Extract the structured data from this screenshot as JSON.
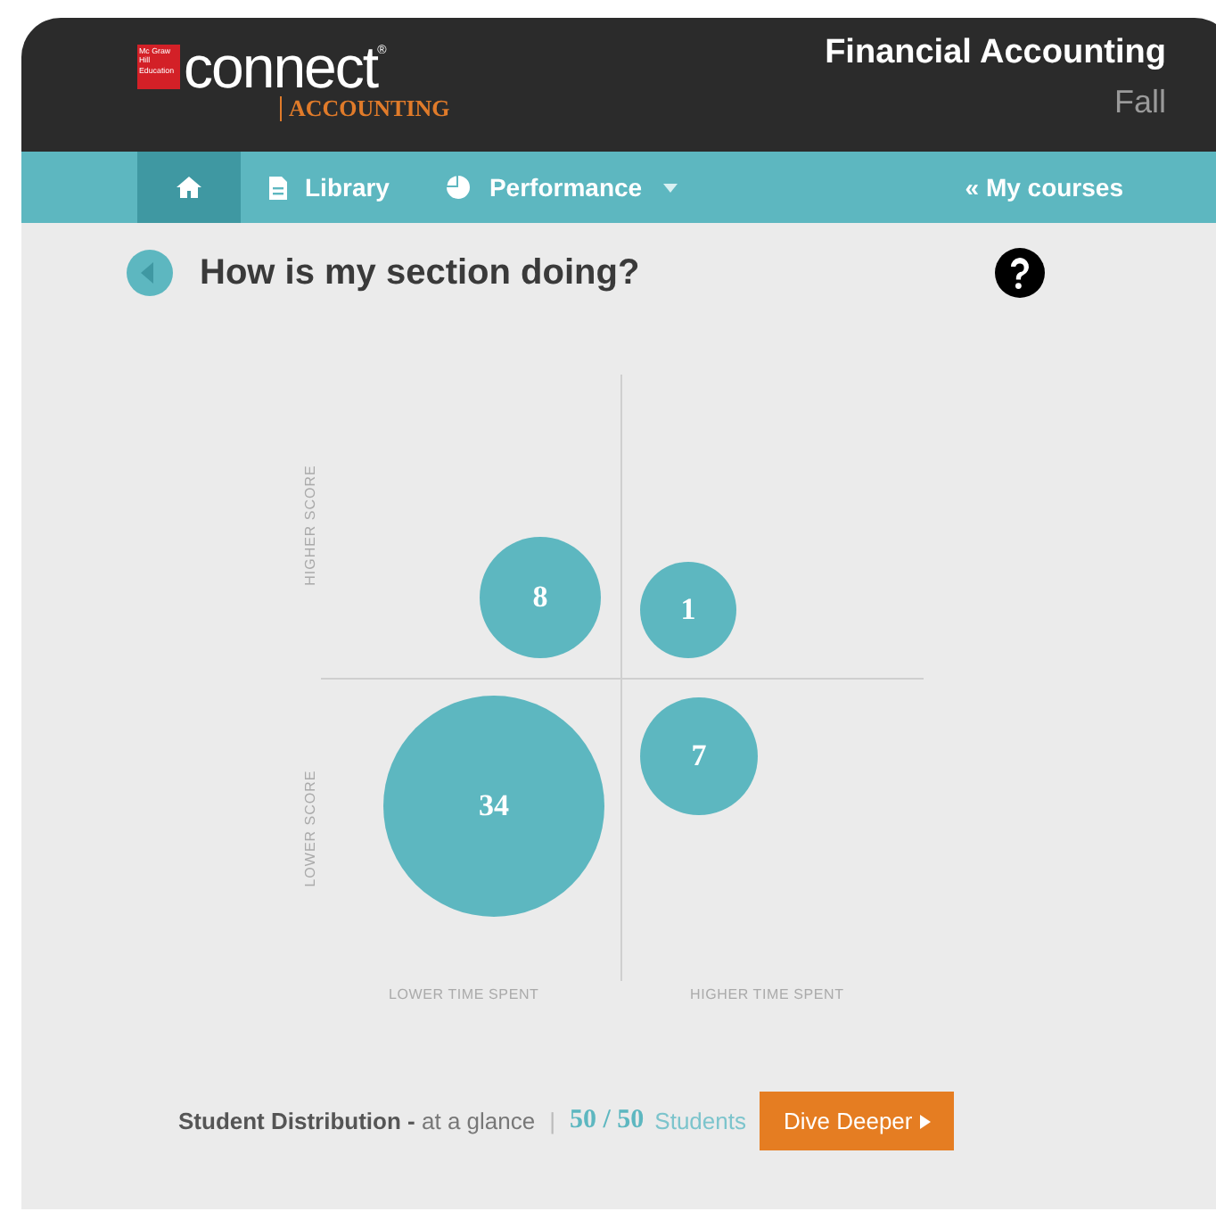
{
  "header": {
    "logo_mark": "Mc Graw Hill Education",
    "logo_word": "connect",
    "logo_reg": "®",
    "product": "ACCOUNTING",
    "course_title": "Financial Accounting",
    "term": "Fall"
  },
  "nav": {
    "items": [
      {
        "kind": "home",
        "selected": true
      },
      {
        "kind": "library",
        "label": "Library",
        "selected": false
      },
      {
        "kind": "performance",
        "label": "Performance",
        "selected": false
      }
    ],
    "my_courses": "« My courses"
  },
  "page": {
    "title": "How is my section doing?"
  },
  "quadrant_chart": {
    "y_labels": [
      "HIGHER SCORE",
      "LOWER SCORE"
    ],
    "x_labels": [
      "LOWER TIME SPENT",
      "HIGHER TIME SPENT"
    ],
    "bubbles": [
      {
        "kind": "top-left",
        "count": "8"
      },
      {
        "kind": "top-right",
        "count": "1"
      },
      {
        "kind": "bottom-left",
        "count": "34"
      },
      {
        "kind": "bottom-right",
        "count": "7"
      }
    ]
  },
  "footer": {
    "summary": "**Student Distribution -** at a glance",
    "separator": "|",
    "ratio": "50 / 50",
    "unit": "Students",
    "button": "Dive Deeper"
  }
}
